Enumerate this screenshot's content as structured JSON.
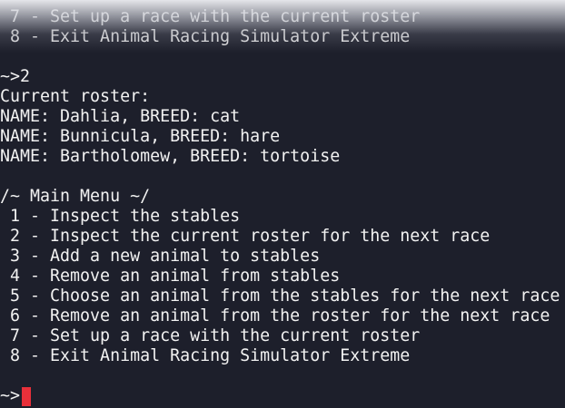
{
  "terminal": {
    "lines": [
      " 7 - Set up a race with the current roster",
      " 8 - Exit Animal Racing Simulator Extreme",
      "",
      "~>2",
      "Current roster:",
      "NAME: Dahlia, BREED: cat",
      "NAME: Bunnicula, BREED: hare",
      "NAME: Bartholomew, BREED: tortoise",
      "",
      "/~ Main Menu ~/",
      " 1 - Inspect the stables",
      " 2 - Inspect the current roster for the next race",
      " 3 - Add a new animal to stables",
      " 4 - Remove an animal from stables",
      " 5 - Choose an animal from the stables for the next race",
      " 6 - Remove an animal from the roster for the next race",
      " 7 - Set up a race with the current roster",
      " 8 - Exit Animal Racing Simulator Extreme",
      "",
      "~>"
    ],
    "colors": {
      "background": "#1d1f2b",
      "text": "#f2f2f2",
      "cursor": "#e8303a"
    }
  }
}
